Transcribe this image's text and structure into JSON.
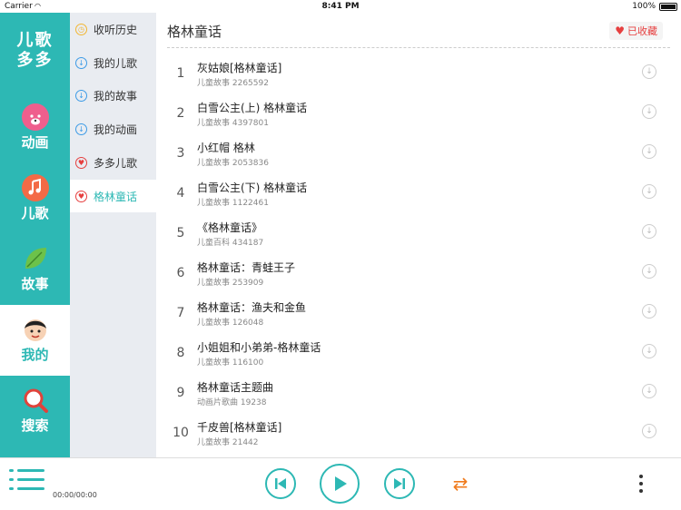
{
  "status_bar": {
    "carrier": "Carrier",
    "time": "8:41 PM",
    "battery": "100%"
  },
  "logo": {
    "line1": "儿歌",
    "line2": "多多"
  },
  "left_nav": [
    {
      "label": "动画",
      "icon": "bear-icon"
    },
    {
      "label": "儿歌",
      "icon": "music-note-icon"
    },
    {
      "label": "故事",
      "icon": "leaf-icon"
    },
    {
      "label": "我的",
      "icon": "boy-avatar-icon",
      "active": true
    },
    {
      "label": "搜索",
      "icon": "magnifier-icon"
    }
  ],
  "sub_nav": [
    {
      "label": "收听历史",
      "icon": "clock-icon"
    },
    {
      "label": "我的儿歌",
      "icon": "download-icon"
    },
    {
      "label": "我的故事",
      "icon": "download-icon"
    },
    {
      "label": "我的动画",
      "icon": "download-icon"
    },
    {
      "label": "多多儿歌",
      "icon": "heart-icon"
    },
    {
      "label": "格林童话",
      "icon": "heart-icon",
      "active": true
    }
  ],
  "main": {
    "title": "格林童话",
    "favorite_label": "已收藏",
    "items": [
      {
        "num": "1",
        "title": "灰姑娘[格林童话]",
        "meta": "儿童故事 2265592"
      },
      {
        "num": "2",
        "title": "白雪公主(上)  格林童话",
        "meta": "儿童故事 4397801"
      },
      {
        "num": "3",
        "title": "小红帽    格林",
        "meta": "儿童故事 2053836"
      },
      {
        "num": "4",
        "title": "白雪公主(下)  格林童话",
        "meta": "儿童故事 1122461"
      },
      {
        "num": "5",
        "title": "《格林童话》",
        "meta": "儿童百科 434187"
      },
      {
        "num": "6",
        "title": "格林童话：青蛙王子",
        "meta": "儿童故事 253909"
      },
      {
        "num": "7",
        "title": "格林童话：渔夫和金鱼",
        "meta": "儿童故事 126048"
      },
      {
        "num": "8",
        "title": "小姐姐和小弟弟-格林童话",
        "meta": "儿童故事 116100"
      },
      {
        "num": "9",
        "title": "格林童话主题曲",
        "meta": "动画片歌曲 19238"
      },
      {
        "num": "10",
        "title": "千皮兽[格林童话]",
        "meta": "儿童故事 21442"
      }
    ]
  },
  "player": {
    "time": "00:00/00:00"
  },
  "colors": {
    "accent": "#2db8b4",
    "favorite": "#e63f3f",
    "repeat": "#f07b1d"
  }
}
